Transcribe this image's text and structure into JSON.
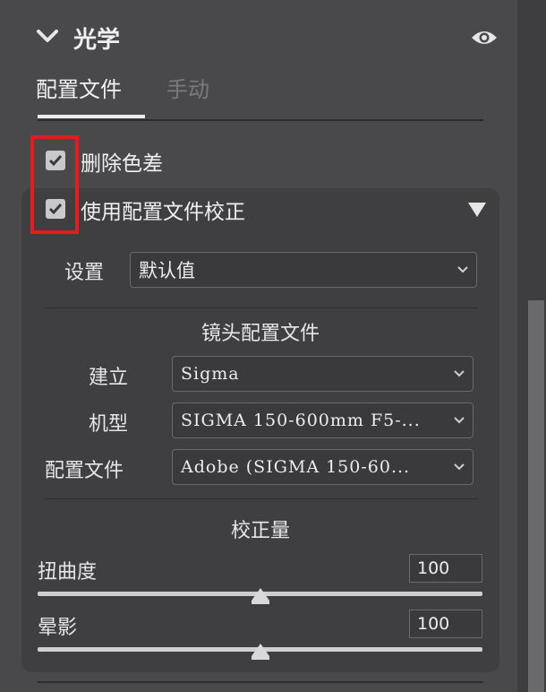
{
  "section": {
    "title": "光学",
    "chevron_icon": "chevron-down-icon",
    "visibility_icon": "eye-icon"
  },
  "tabs": [
    {
      "label": "配置文件",
      "active": true
    },
    {
      "label": "手动",
      "active": false
    }
  ],
  "checkboxes": {
    "remove_ca": {
      "label": "删除色差",
      "checked": true
    },
    "profile_correction": {
      "label": "使用配置文件校正",
      "checked": true
    }
  },
  "settings": {
    "label": "设置",
    "value": "默认值"
  },
  "lens_profile": {
    "header": "镜头配置文件",
    "make": {
      "label": "建立",
      "value": "Sigma"
    },
    "model": {
      "label": "机型",
      "value": "SIGMA 150-600mm F5-..."
    },
    "profile": {
      "label": "配置文件",
      "value": "Adobe (SIGMA 150-60..."
    }
  },
  "correction": {
    "header": "校正量",
    "distortion": {
      "label": "扭曲度",
      "value": "100",
      "slider_fraction": 0.5
    },
    "vignetting": {
      "label": "晕影",
      "value": "100",
      "slider_fraction": 0.5
    }
  },
  "colors": {
    "highlight": "#e31d1d",
    "panel": "#49494c",
    "subpanel": "#3f3f42"
  }
}
